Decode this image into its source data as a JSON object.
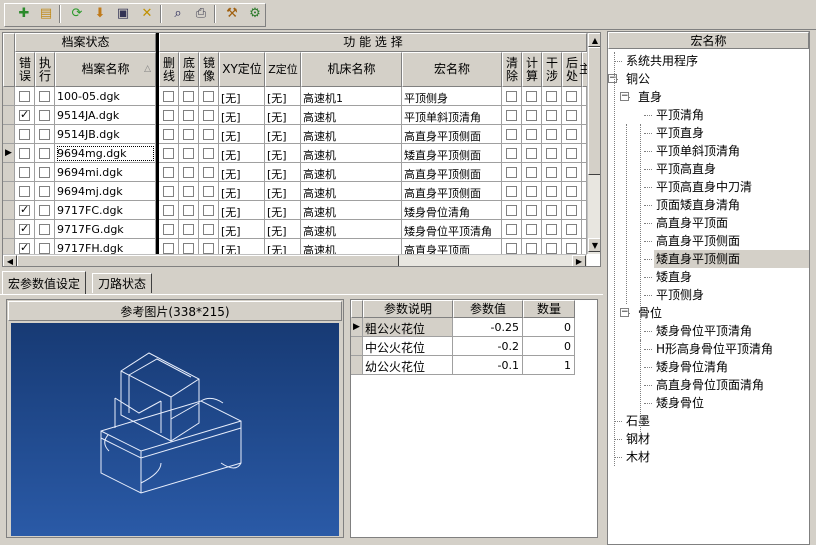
{
  "toolbar": {
    "buttons": [
      "add-icon",
      "open-icon",
      "refresh-icon",
      "download-icon",
      "save-icon",
      "delete-icon",
      "search-icon",
      "print-icon",
      "tools-icon",
      "settings-icon"
    ]
  },
  "grid": {
    "group_archive": "档案状态",
    "group_function": "功 能 选 择",
    "columns": {
      "error": "错误",
      "exec": "执行",
      "name": "档案名称",
      "sort_indicator": "△",
      "delete_line": "删线",
      "base": "底座",
      "mirror": "镜像",
      "xy": "XY定位",
      "z": "Z定位",
      "machine": "机床名称",
      "macro": "宏名称",
      "clear": "清除",
      "calc": "计算",
      "interfere": "干涉",
      "post": "后处",
      "extra": "主"
    },
    "rows": [
      {
        "error": false,
        "exec": false,
        "name": "100-05.dgk",
        "xy": "[无]",
        "z": "[无]",
        "machine": "高速机1",
        "macro": "平顶侧身"
      },
      {
        "error": true,
        "exec": false,
        "name": "9514JA.dgk",
        "xy": "[无]",
        "z": "[无]",
        "machine": "高速机",
        "macro": "平顶单斜顶清角"
      },
      {
        "error": false,
        "exec": false,
        "name": "9514JB.dgk",
        "xy": "[无]",
        "z": "[无]",
        "machine": "高速机",
        "macro": "高直身平顶侧面"
      },
      {
        "error": false,
        "exec": false,
        "name": "9694mg.dgk",
        "xy": "[无]",
        "z": "[无]",
        "machine": "高速机",
        "macro": "矮直身平顶侧面",
        "current": true
      },
      {
        "error": false,
        "exec": false,
        "name": "9694mi.dgk",
        "xy": "[无]",
        "z": "[无]",
        "machine": "高速机",
        "macro": "高直身平顶侧面"
      },
      {
        "error": false,
        "exec": false,
        "name": "9694mj.dgk",
        "xy": "[无]",
        "z": "[无]",
        "machine": "高速机",
        "macro": "高直身平顶侧面"
      },
      {
        "error": true,
        "exec": false,
        "name": "9717FC.dgk",
        "xy": "[无]",
        "z": "[无]",
        "machine": "高速机",
        "macro": "矮身骨位清角"
      },
      {
        "error": true,
        "exec": false,
        "name": "9717FG.dgk",
        "xy": "[无]",
        "z": "[无]",
        "machine": "高速机",
        "macro": "矮身骨位平顶清角"
      },
      {
        "error": true,
        "exec": false,
        "name": "9717FH.dgk",
        "xy": "[无]",
        "z": "[无]",
        "machine": "高速机",
        "macro": "高直身平顶面"
      }
    ]
  },
  "tabs": [
    {
      "label": "宏参数值设定",
      "active": true
    },
    {
      "label": "刀路状态",
      "active": false
    }
  ],
  "ref_image": {
    "title": "参考图片(338*215)"
  },
  "params": {
    "headers": [
      "参数说明",
      "参数值",
      "数量"
    ],
    "rows": [
      {
        "desc": "粗公火花位",
        "value": "-0.25",
        "count": "0",
        "current": true
      },
      {
        "desc": "中公火花位",
        "value": "-0.2",
        "count": "0"
      },
      {
        "desc": "幼公火花位",
        "value": "-0.1",
        "count": "1"
      }
    ]
  },
  "tree": {
    "header": "宏名称",
    "nodes": [
      {
        "label": "系统共用程序",
        "level": 0
      },
      {
        "label": "铜公",
        "level": 0,
        "expanded": true
      },
      {
        "label": "直身",
        "level": 1,
        "expanded": true
      },
      {
        "label": "平顶清角",
        "level": 2
      },
      {
        "label": "平顶直身",
        "level": 2
      },
      {
        "label": "平顶单斜顶清角",
        "level": 2
      },
      {
        "label": "平顶高直身",
        "level": 2
      },
      {
        "label": "平顶高直身中刀清",
        "level": 2
      },
      {
        "label": "顶面矮直身清角",
        "level": 2
      },
      {
        "label": "高直身平顶面",
        "level": 2
      },
      {
        "label": "高直身平顶侧面",
        "level": 2
      },
      {
        "label": "矮直身平顶侧面",
        "level": 2,
        "selected": true
      },
      {
        "label": "矮直身",
        "level": 2
      },
      {
        "label": "平顶侧身",
        "level": 2
      },
      {
        "label": "骨位",
        "level": 1,
        "expanded": true
      },
      {
        "label": "矮身骨位平顶清角",
        "level": 2
      },
      {
        "label": "H形高身骨位平顶清角",
        "level": 2
      },
      {
        "label": "矮身骨位清角",
        "level": 2
      },
      {
        "label": "高直身骨位顶面清角",
        "level": 2
      },
      {
        "label": "矮身骨位",
        "level": 2
      },
      {
        "label": "石墨",
        "level": 0
      },
      {
        "label": "钢材",
        "level": 0
      },
      {
        "label": "木材",
        "level": 0
      }
    ]
  },
  "colors": {
    "window_bg": "#d4d0c8",
    "image_bg_top": "#173a74",
    "image_bg_bottom": "#2a5aa7",
    "selection": "#d4d0c8"
  }
}
